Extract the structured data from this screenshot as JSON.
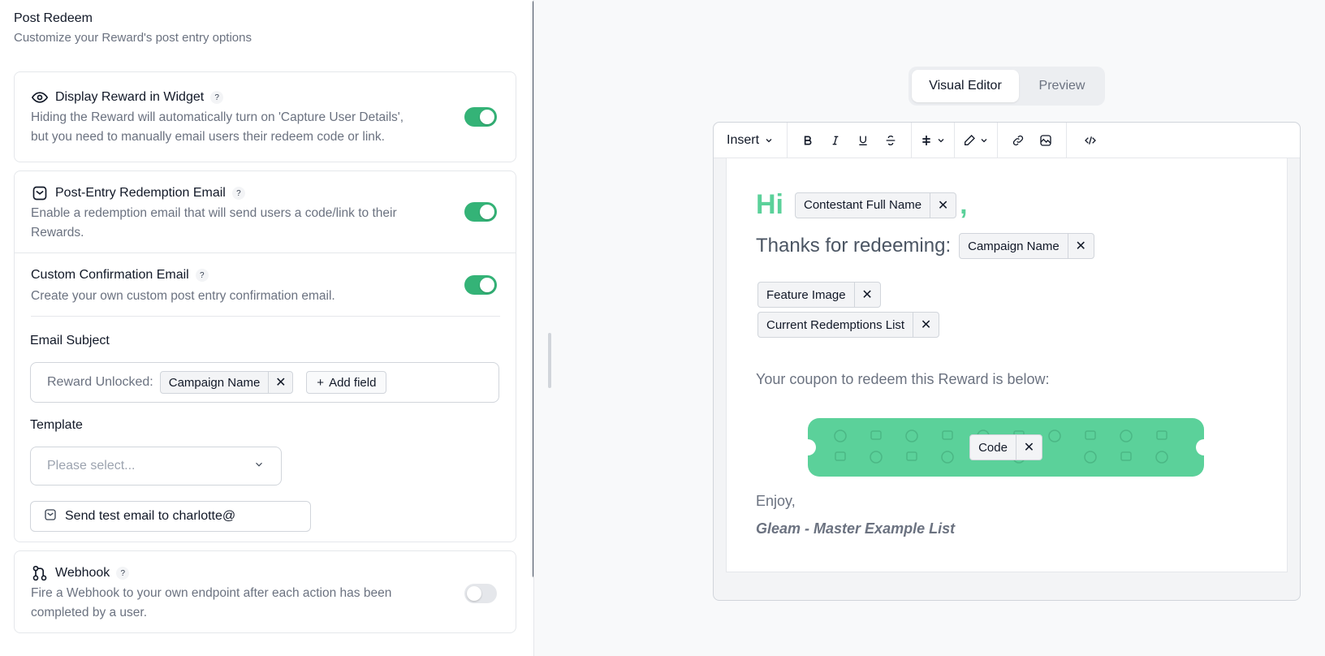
{
  "post_redeem": {
    "title": "Post Redeem",
    "subtitle": "Customize your Reward's post entry options"
  },
  "display_reward": {
    "title": "Display Reward in Widget",
    "help": "?",
    "description_line1": "Hiding the Reward will automatically turn on 'Capture User Details',",
    "description_line2": "but you need to manually email users their redeem code or link.",
    "enabled": true
  },
  "redemption_email": {
    "title": "Post-Entry Redemption Email",
    "help": "?",
    "description_line1": "Enable a redemption email that will send users a code/link to their",
    "description_line2": "Rewards.",
    "enabled": true
  },
  "confirmation_email": {
    "title": "Custom Confirmation Email",
    "help": "?",
    "description": "Create your own custom post entry confirmation email.",
    "enabled": true
  },
  "email_subject": {
    "label": "Email Subject",
    "prefix": "Reward Unlocked:",
    "field_chip": "Campaign Name",
    "add_field_label": "Add field"
  },
  "template": {
    "label": "Template",
    "placeholder": "Please select..."
  },
  "test_email": {
    "label": "Send test email to charlotte@"
  },
  "webhook": {
    "title": "Webhook",
    "help": "?",
    "description_line1": "Fire a Webhook to your own endpoint after each action has been",
    "description_line2": "completed by a user.",
    "enabled": false
  },
  "editor_tabs": {
    "visual": "Visual Editor",
    "preview": "Preview",
    "active": "visual"
  },
  "toolbar": {
    "insert_label": "Insert"
  },
  "email_body": {
    "greeting": "Hi",
    "greeting_chip": "Contestant Full Name",
    "greeting_comma": ",",
    "thanks_text": "Thanks for redeeming:",
    "thanks_chip": "Campaign Name",
    "feature_chip": "Feature Image",
    "redemptions_chip": "Current Redemptions List",
    "coupon_intro": "Your coupon to redeem this Reward is below:",
    "coupon_chip": "Code",
    "closing": "Enjoy,",
    "signature": "Gleam - Master Example List"
  },
  "colors": {
    "accent_green": "#34b377",
    "coupon_green": "#5bd19a",
    "toggle_off": "#e5e7eb"
  }
}
